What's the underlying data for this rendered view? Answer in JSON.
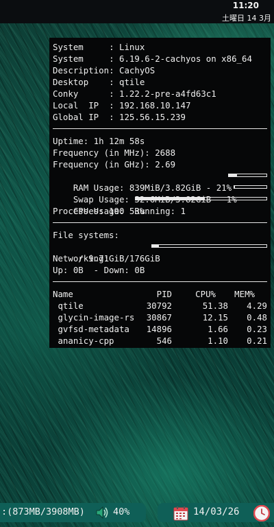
{
  "topbar": {
    "time": "11:20",
    "date": "土曜日 14 3月"
  },
  "conky": {
    "info": [
      {
        "label": "System     ",
        "value": "Linux"
      },
      {
        "label": "System     ",
        "value": "6.19.6-2-cachyos on x86_64"
      },
      {
        "label": "Description",
        "value": "CachyOS"
      },
      {
        "label": "Desktop    ",
        "value": "qtile"
      },
      {
        "label": "Conky      ",
        "value": "1.22.2-pre-a4fd63c1"
      },
      {
        "label": "Local  IP  ",
        "value": "192.168.10.147"
      },
      {
        "label": "Global IP  ",
        "value": "125.56.15.239"
      }
    ],
    "uptime": "Uptime: 1h 12m 58s",
    "freq_mhz": "Frequency (in MHz): 2688",
    "freq_ghz": "Frequency (in GHz): 2.69",
    "ram": {
      "text": "RAM Usage: 839MiB/3.82GiB - 21%",
      "percent": 21
    },
    "swap": {
      "text": "Swap Usage: 52.6MiB/3.82GiB - 1%",
      "percent": 1
    },
    "cpu": {
      "text": "CPU Usage: 53%",
      "percent": 53
    },
    "processes": "Processes: 190  Running: 1",
    "fs_title": "File systems:",
    "fs_root": {
      "text": " / 9.71GiB/176GiB",
      "percent": 6
    },
    "net_title": "Networking:",
    "net_line": "Up: 0B  - Down: 0B",
    "proc_headers": {
      "name": "Name",
      "pid": "PID",
      "cpu": "CPU%",
      "mem": "MEM%"
    },
    "procs": [
      {
        "name": " qtile",
        "pid": "30792",
        "cpu": "51.38",
        "mem": "4.29"
      },
      {
        "name": " glycin-image-rs",
        "pid": "30867",
        "cpu": "12.15",
        "mem": "0.48"
      },
      {
        "name": " gvfsd-metadata",
        "pid": "14896",
        "cpu": "1.66",
        "mem": "0.23"
      },
      {
        "name": " ananicy-cpp",
        "pid": "546",
        "cpu": "1.10",
        "mem": "0.21"
      }
    ]
  },
  "bottombar": {
    "memory": ":(873MB/3908MB)",
    "volume": "40%",
    "date": "14/03/26",
    "icons": {
      "volume": "speaker-icon",
      "calendar": "calendar-icon",
      "clock": "clock-icon"
    },
    "colors": {
      "pill": "#0f5f57",
      "accent": "#e0484f"
    }
  }
}
